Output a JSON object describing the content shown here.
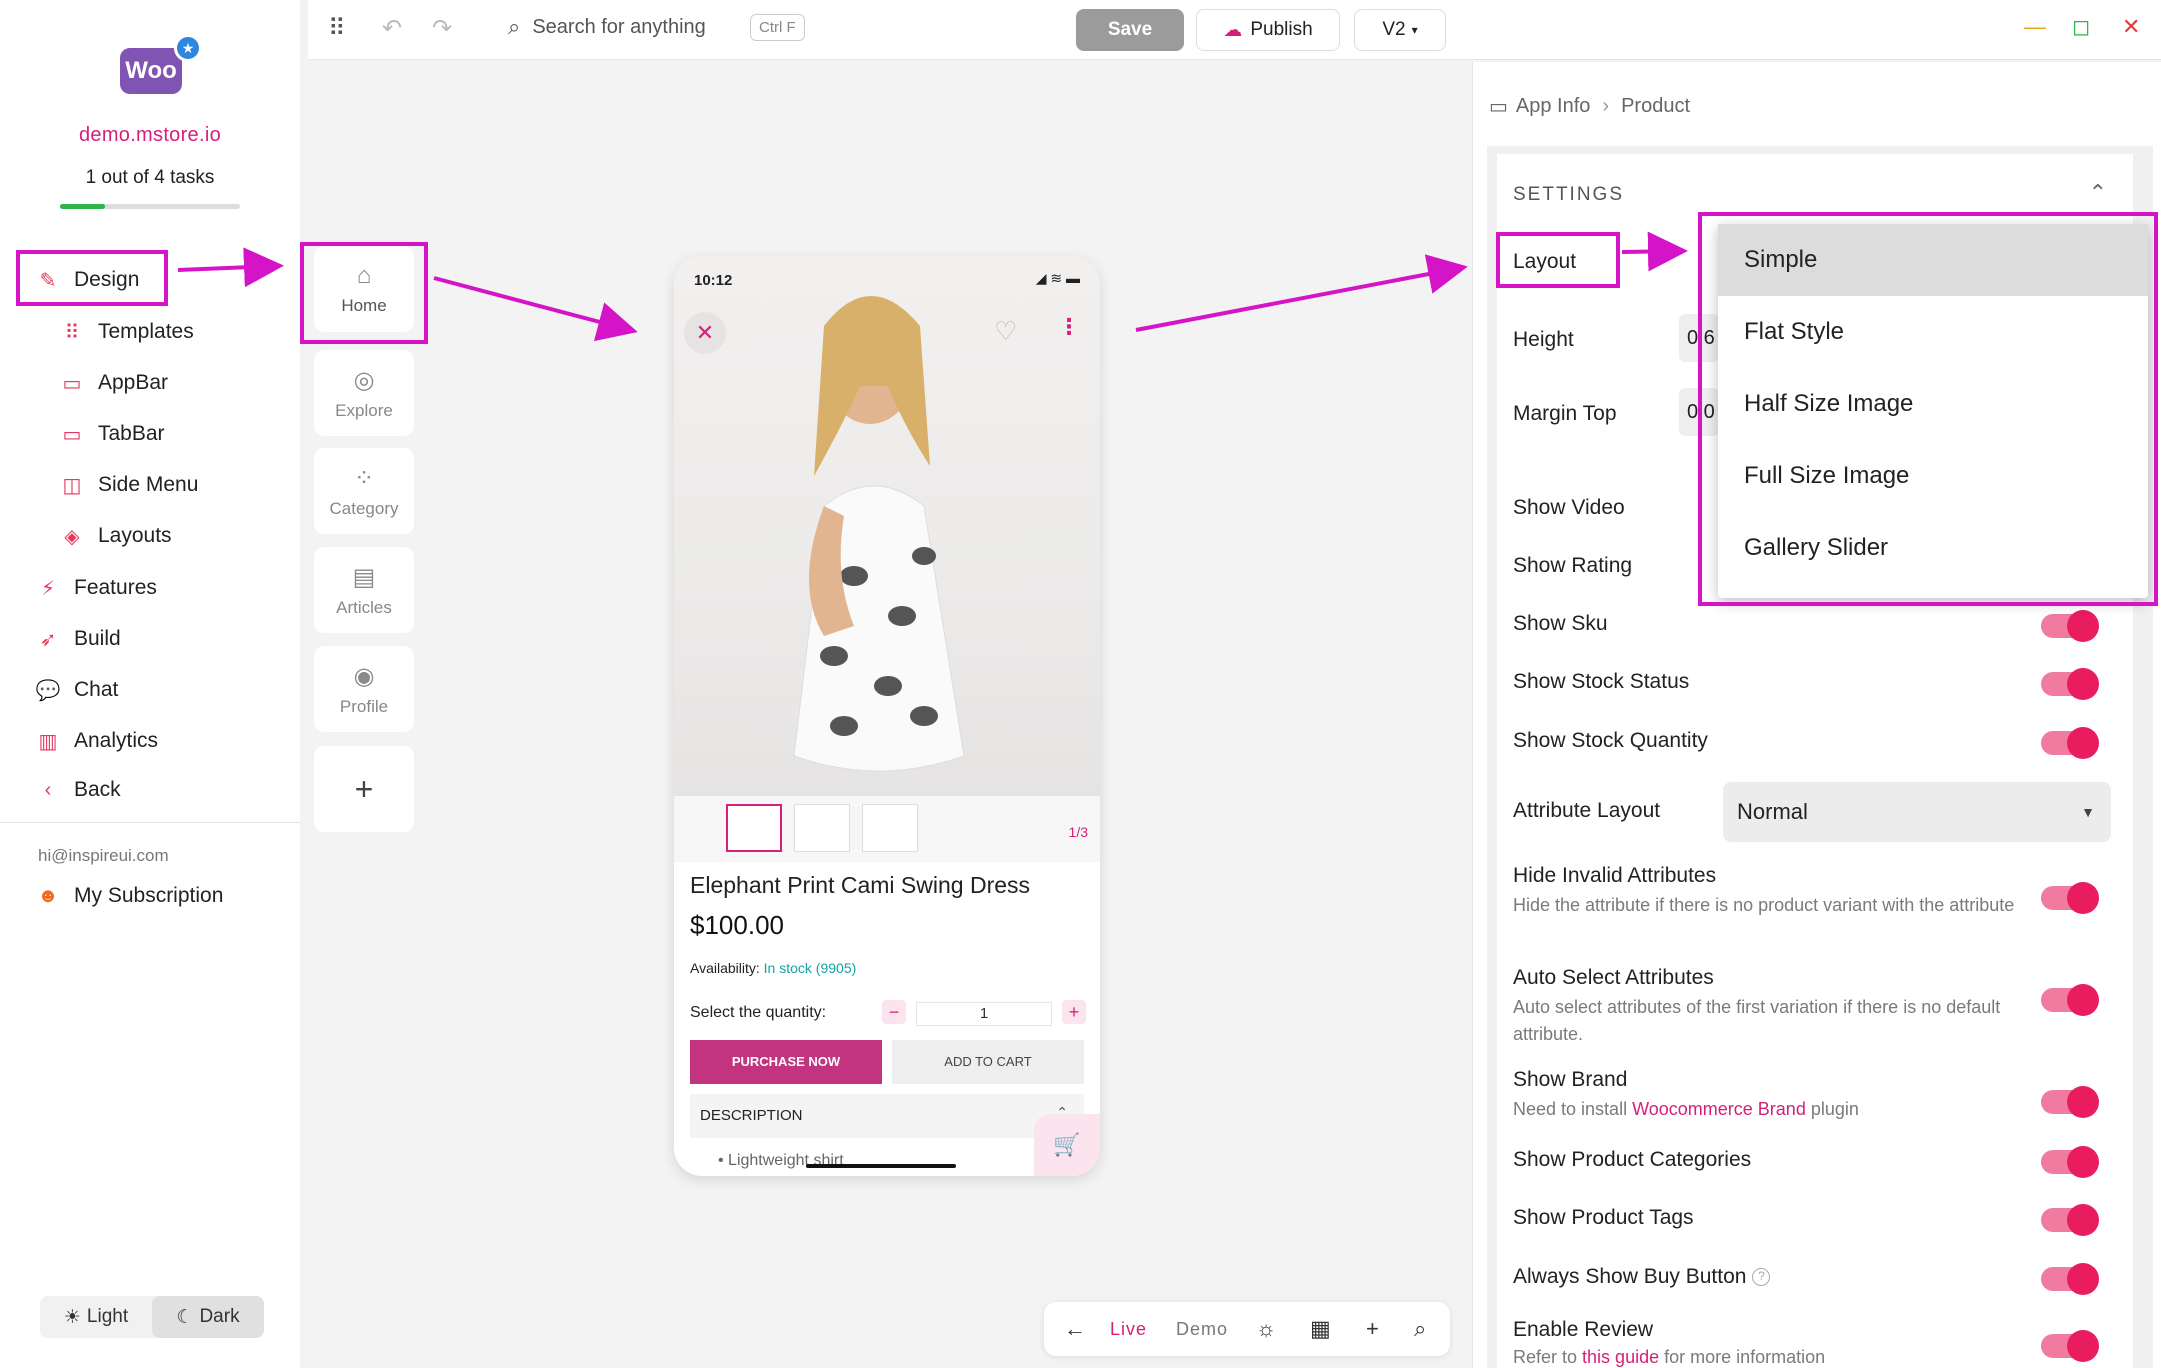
{
  "sidebar": {
    "logo_text": "Woo",
    "domain": "demo.mstore.io",
    "tasks_text": "1 out of 4 tasks",
    "progress": 0.25,
    "design_label": "Design",
    "sub_items": [
      "Templates",
      "AppBar",
      "TabBar",
      "Side Menu",
      "Layouts"
    ],
    "main_items": [
      "Features",
      "Build",
      "Chat",
      "Analytics",
      "Back"
    ],
    "email": "hi@inspireui.com",
    "subscription": "My Subscription",
    "theme": {
      "light": "Light",
      "dark": "Dark",
      "selected": "dark"
    }
  },
  "topbar": {
    "search_placeholder": "Search for anything",
    "shortcut": "Ctrl F",
    "save_label": "Save",
    "publish_label": "Publish",
    "version_label": "V2"
  },
  "tabs": [
    "Home",
    "Explore",
    "Category",
    "Articles",
    "Profile"
  ],
  "phone": {
    "time": "10:12",
    "page_indicator": "1/3",
    "product_title": "Elephant Print Cami Swing Dress",
    "price": "$100.00",
    "availability_label": "Availability:",
    "availability_value": "In stock (9905)",
    "quantity_label": "Select the quantity:",
    "quantity_value": "1",
    "purchase_label": "PURCHASE NOW",
    "cart_label": "ADD TO CART",
    "description_label": "DESCRIPTION",
    "bullet_text": "Lightweight shirt"
  },
  "bottombar": {
    "live": "Live",
    "demo": "Demo"
  },
  "panel": {
    "breadcrumb": [
      "App Info",
      "Product"
    ],
    "settings_title": "SETTINGS",
    "layout_label": "Layout",
    "height_label": "Height",
    "height_value": "0.6",
    "margin_top_label": "Margin Top",
    "margin_top_value": "0.0",
    "show_video": "Show Video",
    "show_rating": "Show Rating",
    "show_sku": "Show Sku",
    "show_stock_status": "Show Stock Status",
    "show_stock_quantity": "Show Stock Quantity",
    "attribute_layout_label": "Attribute Layout",
    "attribute_layout_value": "Normal",
    "hide_invalid_label": "Hide Invalid Attributes",
    "hide_invalid_sub": "Hide the attribute if there is no product variant with the attribute",
    "auto_select_label": "Auto Select Attributes",
    "auto_select_sub": "Auto select attributes of the first variation if there is no default attribute.",
    "show_brand_label": "Show Brand",
    "show_brand_sub_pre": "Need to install",
    "show_brand_sub_link": "Woocommerce Brand",
    "show_brand_sub_post": "plugin",
    "show_categories": "Show Product Categories",
    "show_tags": "Show Product Tags",
    "always_buy": "Always Show Buy Button",
    "enable_review_label": "Enable Review",
    "enable_review_sub_pre": "Refer to",
    "enable_review_sub_link": "this guide",
    "enable_review_sub_post": "for more information"
  },
  "dropdown": {
    "options": [
      "Simple",
      "Flat Style",
      "Half Size Image",
      "Full Size Image",
      "Gallery Slider"
    ],
    "selected": "Simple"
  },
  "colors": {
    "accent": "#d61f7a",
    "annotation": "#d513c7",
    "toggle": "#e81c5e"
  }
}
